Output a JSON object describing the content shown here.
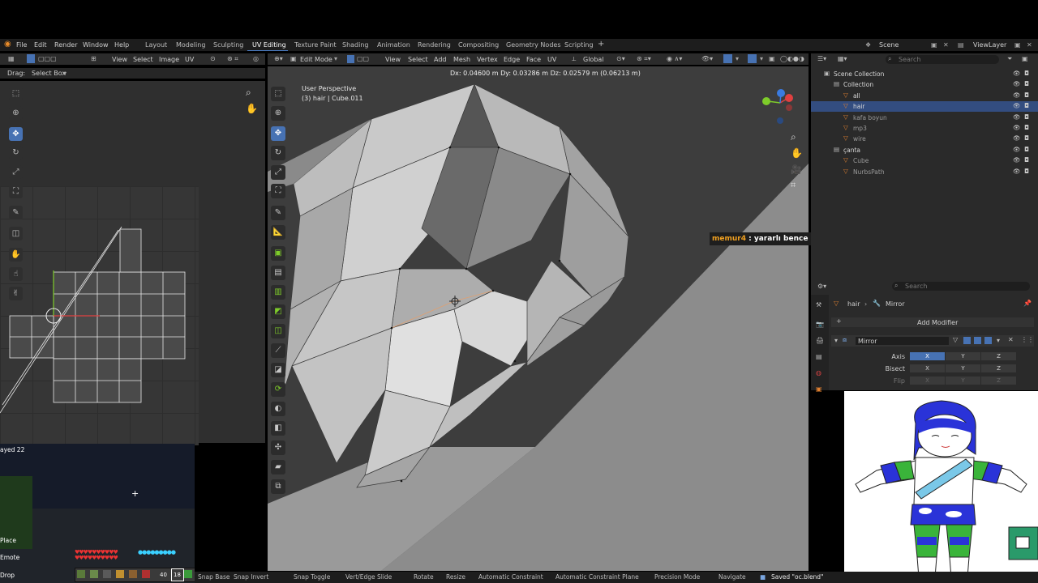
{
  "menu": {
    "items": [
      "File",
      "Edit",
      "Render",
      "Window",
      "Help"
    ],
    "workspaces": [
      "Layout",
      "Modeling",
      "Sculpting",
      "UV Editing",
      "Texture Paint",
      "Shading",
      "Animation",
      "Rendering",
      "Compositing",
      "Geometry Nodes",
      "Scripting"
    ],
    "active_workspace": "UV Editing",
    "add_symbol": "+",
    "scene_label": "Scene",
    "view_layer_label": "ViewLayer"
  },
  "uv_editor": {
    "header_items": [
      "View",
      "Select",
      "Image",
      "UV"
    ],
    "tool_header": {
      "drag_label": "Drag:",
      "drag_value": "Select Box"
    },
    "grid_plus": "+"
  },
  "viewport": {
    "mode": "Edit Mode",
    "header_items": [
      "View",
      "Select",
      "Add",
      "Mesh",
      "Vertex",
      "Edge",
      "Face",
      "UV"
    ],
    "transform_orientation": "Global",
    "delta_readout": "Dx: 0.04600 m  Dy: 0.03286 m  Dz: 0.02579 m (0.06213 m)",
    "overlay_title": "User Perspective",
    "overlay_object": "(3) hair | Cube.011",
    "search_placeholder": "Search"
  },
  "chat": {
    "user": "memur4",
    "message": " : yararlı bence bireysel olarak"
  },
  "outliner": {
    "search_placeholder": "Search",
    "rows": [
      {
        "label": "Scene Collection",
        "indent": 0,
        "selected": false
      },
      {
        "label": "Collection",
        "indent": 1,
        "selected": false
      },
      {
        "label": "all",
        "indent": 2,
        "selected": false
      },
      {
        "label": "hair",
        "indent": 2,
        "selected": true
      },
      {
        "label": "kafa boyun",
        "indent": 2,
        "selected": false
      },
      {
        "label": "mp3",
        "indent": 2,
        "selected": false
      },
      {
        "label": "wire",
        "indent": 2,
        "selected": false
      },
      {
        "label": "çanta",
        "indent": 1,
        "selected": false
      },
      {
        "label": "Cube",
        "indent": 2,
        "selected": false
      },
      {
        "label": "NurbsPath",
        "indent": 2,
        "selected": false
      }
    ]
  },
  "properties": {
    "search_placeholder": "Search",
    "breadcrumb_object": "hair",
    "breadcrumb_modifier": "Mirror",
    "add_modifier": "Add Modifier",
    "modifier_name": "Mirror",
    "rows": [
      {
        "label": "Axis",
        "x": "X",
        "y": "Y",
        "z": "Z"
      },
      {
        "label": "Bisect",
        "x": "X",
        "y": "Y",
        "z": "Z"
      },
      {
        "label": "Flip",
        "x": "X",
        "y": "Y",
        "z": "Z"
      }
    ]
  },
  "minecraft": {
    "layer_text": "ayed 22",
    "crosshair": "+",
    "hints": [
      "Place",
      "Emote",
      "Drop"
    ],
    "hotbar_count_1": "40",
    "hotbar_count_2": "18"
  },
  "status": {
    "items": [
      "Snap Base",
      "Snap Invert",
      "Snap Toggle",
      "Vert/Edge Slide",
      "Rotate",
      "Resize",
      "Automatic Constraint",
      "Automatic Constraint Plane",
      "Precision Mode",
      "Navigate"
    ],
    "saved": "Saved \"oc.blend\""
  },
  "colors": {
    "accent": "#4772b3",
    "chat_user": "#f0a020",
    "axis_x": "#e04040",
    "axis_y": "#7ecc2a",
    "axis_z": "#3a7be0"
  }
}
